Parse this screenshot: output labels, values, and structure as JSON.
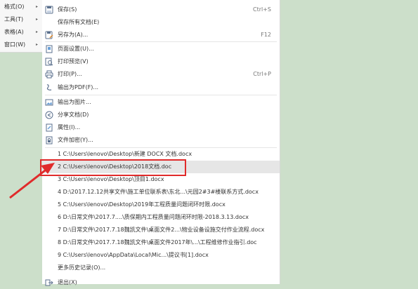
{
  "left_menu": {
    "items": [
      {
        "label": "格式(O)",
        "arrow": "▸"
      },
      {
        "label": "工具(T)",
        "arrow": "▸"
      },
      {
        "label": "表格(A)",
        "arrow": "▸"
      },
      {
        "label": "窗口(W)",
        "arrow": "▸"
      }
    ]
  },
  "file_menu": {
    "save": {
      "label": "保存(S)",
      "shortcut": "Ctrl+S"
    },
    "save_all": {
      "label": "保存所有文档(E)"
    },
    "save_as": {
      "label": "另存为(A)...",
      "shortcut": "F12"
    },
    "page_setup": {
      "label": "页面设置(U)..."
    },
    "print_preview": {
      "label": "打印预览(V)"
    },
    "print": {
      "label": "打印(P)...",
      "shortcut": "Ctrl+P"
    },
    "export_pdf": {
      "label": "输出为PDF(F)..."
    },
    "export_image": {
      "label": "输出为图片..."
    },
    "share": {
      "label": "分享文档(D)"
    },
    "properties": {
      "label": "属性(I)..."
    },
    "encrypt": {
      "label": "文件加密(Y)..."
    },
    "recent_files": [
      "1 C:\\Users\\lenovo\\Desktop\\新建 DOCX 文档.docx",
      "2 C:\\Users\\lenovo\\Desktop\\2018文档.doc",
      "3 C:\\Users\\lenovo\\Desktop\\顶目1.docx",
      "4 D:\\2017.12.12共享文件\\施工单位联系表\\东北...\\元园2#3#楼联系方式.docx",
      "5 C:\\Users\\lenovo\\Desktop\\2019年工程质量问题闭环时限.docx",
      "6 D:\\日常文件\\2017.7....\\质保期内工程质量问题闭环时限-2018.3.13.docx",
      "7 D:\\日常文件\\2017.7.18魏凯文件\\桌面文件2...\\物业设备设施交付作业流程.docx",
      "8 D:\\日常文件\\2017.7.18魏凯文件\\桌面文件2017年\\...\\工程维修作业指引.doc",
      "9 C:\\Users\\lenovo\\AppData\\Local\\Mic...\\提议书[1].docx"
    ],
    "more_history": {
      "label": "更多历史记录(O)..."
    },
    "exit": {
      "label": "退出(X)"
    }
  },
  "colors": {
    "document_background": "#ccdfca",
    "highlight_border": "#e02b2b",
    "annotation_arrow": "#e02b2b",
    "hover_row": "#e6e6e6"
  }
}
